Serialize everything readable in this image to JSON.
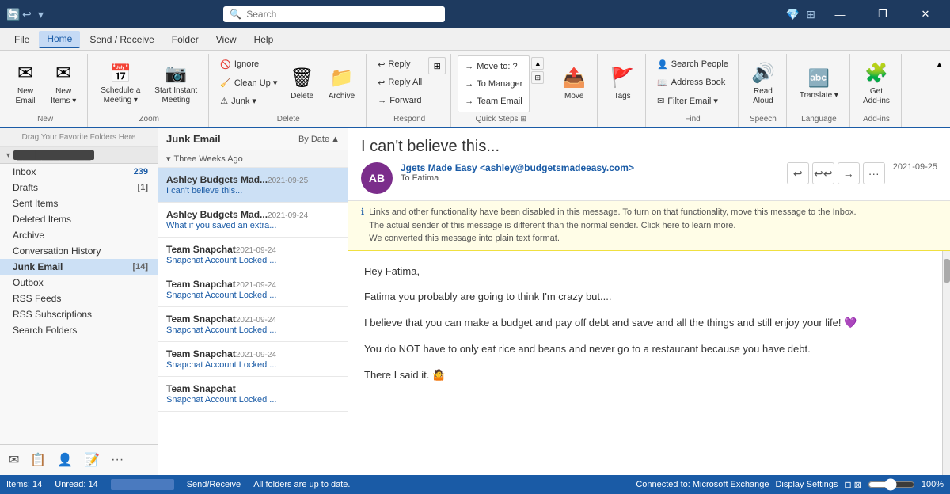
{
  "titlebar": {
    "search_placeholder": "Search",
    "win_min": "—",
    "win_restore": "❐",
    "win_close": "✕"
  },
  "menubar": {
    "items": [
      "File",
      "Home",
      "Send / Receive",
      "Folder",
      "View",
      "Help"
    ],
    "active": "Home"
  },
  "ribbon": {
    "groups": [
      {
        "label": "New",
        "buttons": [
          {
            "icon": "✉",
            "text": "New\nEmail",
            "large": true
          },
          {
            "icon": "✉",
            "text": "New\nItems ▾",
            "large": true
          }
        ]
      },
      {
        "label": "Zoom",
        "buttons": [
          {
            "icon": "📅",
            "text": "Schedule a\nMeeting ▾",
            "large": true
          },
          {
            "icon": "📷",
            "text": "Start Instant\nMeeting",
            "large": true
          }
        ]
      },
      {
        "label": "Delete",
        "buttons_small": [
          {
            "icon": "🚫",
            "text": "Ignore"
          },
          {
            "icon": "🧹",
            "text": "Clean Up ▾"
          },
          {
            "icon": "⚠",
            "text": "Junk ▾"
          }
        ],
        "buttons_large": [
          {
            "icon": "🗑",
            "text": "Delete",
            "large": true
          },
          {
            "icon": "📁",
            "text": "Archive",
            "large": true
          }
        ]
      },
      {
        "label": "Respond",
        "buttons_small": [
          {
            "icon": "↩",
            "text": "Reply"
          },
          {
            "icon": "↩↩",
            "text": "Reply All"
          },
          {
            "icon": "→",
            "text": "Forward"
          }
        ],
        "extra": {
          "icon": "⊞",
          "text": "More"
        }
      },
      {
        "label": "Quick Steps",
        "items": [
          {
            "icon": "→",
            "text": "Move to: ?"
          },
          {
            "icon": "→",
            "text": "To Manager"
          },
          {
            "icon": "→",
            "text": "Team Email"
          }
        ],
        "expand_icon": "⊞"
      },
      {
        "label": "",
        "buttons_large": [
          {
            "icon": "📤",
            "text": "Move",
            "large": true
          }
        ]
      },
      {
        "label": "",
        "buttons_large": [
          {
            "icon": "🚩",
            "text": "Tags",
            "large": true
          }
        ]
      },
      {
        "label": "Find",
        "items": [
          {
            "icon": "👤",
            "text": "Search People"
          },
          {
            "icon": "📖",
            "text": "Address Book"
          },
          {
            "icon": "✉",
            "text": "Filter Email ▾"
          }
        ]
      },
      {
        "label": "Speech",
        "buttons_large": [
          {
            "icon": "🔊",
            "text": "Read\nAloud",
            "large": true
          }
        ]
      },
      {
        "label": "Language",
        "buttons_large": [
          {
            "icon": "🔤",
            "text": "Translate ▾",
            "large": true
          }
        ]
      },
      {
        "label": "Add-ins",
        "buttons_large": [
          {
            "icon": "🧩",
            "text": "Get\nAdd-ins",
            "large": true
          }
        ]
      }
    ]
  },
  "sidebar": {
    "drag_area": "Drag Your Favorite Folders Here",
    "account": "████████████",
    "folders": [
      {
        "name": "Inbox",
        "count": "239",
        "count_color": "blue",
        "active": false
      },
      {
        "name": "Drafts",
        "count": "[1]",
        "count_color": "gray",
        "active": false
      },
      {
        "name": "Sent Items",
        "count": "",
        "active": false
      },
      {
        "name": "Deleted Items",
        "count": "",
        "active": false
      },
      {
        "name": "Archive",
        "count": "",
        "active": false
      },
      {
        "name": "Conversation History",
        "count": "",
        "active": false
      },
      {
        "name": "Junk Email",
        "count": "[14]",
        "count_color": "gray",
        "active": true
      },
      {
        "name": "Outbox",
        "count": "",
        "active": false
      },
      {
        "name": "RSS Feeds",
        "count": "",
        "active": false
      },
      {
        "name": "RSS Subscriptions",
        "count": "",
        "active": false
      },
      {
        "name": "Search Folders",
        "count": "",
        "active": false
      }
    ],
    "bottom_icons": [
      "✉",
      "📋",
      "👤",
      "📝",
      "···"
    ]
  },
  "email_list": {
    "title": "Junk Email",
    "sort_label": "By Date",
    "groups": [
      {
        "label": "Three Weeks Ago",
        "emails": [
          {
            "sender": "Ashley Budgets Mad...",
            "subject": "I can't believe this...",
            "date": "2021-09-25",
            "selected": true
          },
          {
            "sender": "Ashley Budgets Mad...",
            "subject": "What if you saved an extra...",
            "date": "2021-09-24",
            "selected": false
          },
          {
            "sender": "Team Snapchat",
            "subject": "Snapchat Account Locked ...",
            "date": "2021-09-24",
            "selected": false
          },
          {
            "sender": "Team Snapchat",
            "subject": "Snapchat Account Locked ...",
            "date": "2021-09-24",
            "selected": false
          },
          {
            "sender": "Team Snapchat",
            "subject": "Snapchat Account Locked ...",
            "date": "2021-09-24",
            "selected": false
          },
          {
            "sender": "Team Snapchat",
            "subject": "Snapchat Account Locked ...",
            "date": "2021-09-24",
            "selected": false
          },
          {
            "sender": "Team Snapchat",
            "subject": "Snapchat Account Locked ...",
            "date": "...",
            "selected": false
          }
        ]
      }
    ]
  },
  "reading_pane": {
    "subject": "I can't believe this...",
    "avatar_initials": "AB",
    "sender_display": "Jgets Made Easy <ashley@budgetsmadeeasy.com>",
    "to": "To  Fatima",
    "date": "2021-09-25",
    "warning_text": "Links and other functionality have been disabled in this message. To turn on that functionality, move\nthis message to the Inbox.\nThe actual sender of this message is different than the normal sender. Click here to learn more.\nWe converted this message into plain text format.",
    "body_lines": [
      "Hey Fatima,",
      "",
      "Fatima you probably are going to think I'm crazy but....",
      "",
      "I believe that you can make a budget and pay off debt and save and all the things and still enjoy your life! 💜",
      "",
      "You do NOT have to only eat rice and beans and never go to a restaurant because you have debt.",
      "",
      "There I said it. 🤷"
    ],
    "actions": [
      "↩",
      "↩↩",
      "→",
      "···"
    ]
  },
  "statusbar": {
    "items_label": "Items: 14",
    "unread_label": "Unread: 14",
    "send_receive_label": "Send/Receive",
    "all_folders_label": "All folders are up to date.",
    "connected_label": "Connected to: Microsoft Exchange",
    "display_settings_label": "Display Settings",
    "zoom_percent": "100%"
  }
}
